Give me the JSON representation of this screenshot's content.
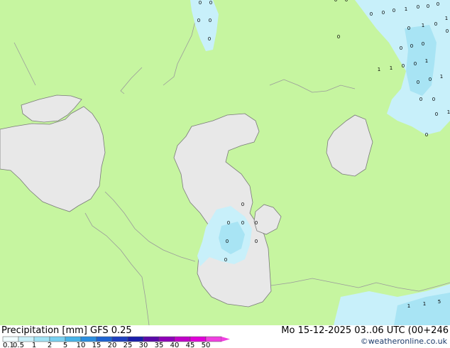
{
  "title": "Precipitation [mm]  GFS 0.25",
  "date": "Mo 15-12-2025 03..06 UTC (00+246",
  "copyright": "©weatheronline.co.uk",
  "colors": {
    "land": "#c6f5a0",
    "water": "#e8e8e8",
    "border": "#9a9a9a",
    "coast": "#7a7a7a",
    "precip_light": "#c8f0fa",
    "precip_mid": "#a8e4f4"
  },
  "legend": {
    "values": [
      "0.1",
      "0.5",
      "1",
      "2",
      "5",
      "10",
      "15",
      "20",
      "25",
      "30",
      "35",
      "40",
      "45",
      "50"
    ],
    "colors": [
      "#f0fcff",
      "#c8f0fa",
      "#a0e2f4",
      "#78d0f0",
      "#48b4e8",
      "#2a8ee0",
      "#1e64d2",
      "#1e40c0",
      "#1a1eaa",
      "#5a0aa8",
      "#8e00b8",
      "#c000c8",
      "#e000d8",
      "#f040e0"
    ]
  },
  "map_labels": [
    "0",
    "0",
    "0",
    "0",
    "0",
    "0",
    "0",
    "0",
    "0",
    "0",
    "0",
    "1",
    "0",
    "0",
    "0",
    "0",
    "1",
    "0",
    "0",
    "1",
    "0",
    "0",
    "0",
    "1",
    "1",
    "0",
    "0",
    "1",
    "0",
    "0",
    "1",
    "0",
    "0",
    "0",
    "1",
    "0",
    "0",
    "0",
    "0",
    "0",
    "0",
    "0",
    "0",
    "1",
    "5",
    "1"
  ]
}
